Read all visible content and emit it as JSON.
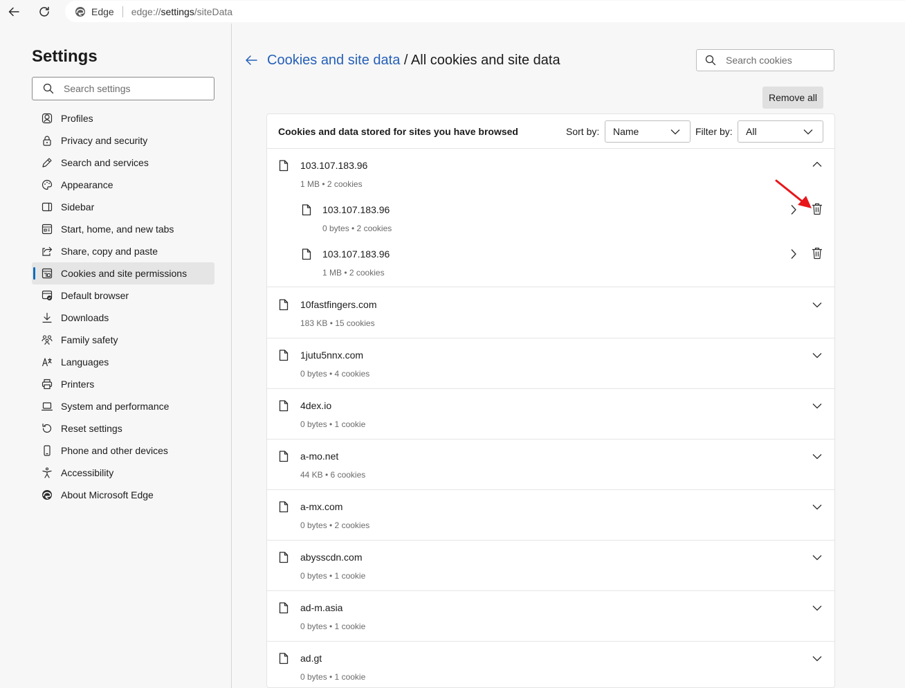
{
  "browser": {
    "brand": "Edge",
    "url_prefix": "edge://",
    "url_settings": "settings",
    "url_suffix": "/siteData"
  },
  "sidebar": {
    "title": "Settings",
    "search_placeholder": "Search settings",
    "items": [
      {
        "label": "Profiles",
        "icon": "profile-icon"
      },
      {
        "label": "Privacy and security",
        "icon": "lock-icon"
      },
      {
        "label": "Search and services",
        "icon": "pencil-icon"
      },
      {
        "label": "Appearance",
        "icon": "palette-icon"
      },
      {
        "label": "Sidebar",
        "icon": "sidebar-icon"
      },
      {
        "label": "Start, home, and new tabs",
        "icon": "home-tabs-icon"
      },
      {
        "label": "Share, copy and paste",
        "icon": "share-icon"
      },
      {
        "label": "Cookies and site permissions",
        "icon": "cookies-icon",
        "active": true
      },
      {
        "label": "Default browser",
        "icon": "default-browser-icon"
      },
      {
        "label": "Downloads",
        "icon": "download-icon"
      },
      {
        "label": "Family safety",
        "icon": "family-icon"
      },
      {
        "label": "Languages",
        "icon": "languages-icon"
      },
      {
        "label": "Printers",
        "icon": "printer-icon"
      },
      {
        "label": "System and performance",
        "icon": "laptop-icon"
      },
      {
        "label": "Reset settings",
        "icon": "reset-icon"
      },
      {
        "label": "Phone and other devices",
        "icon": "phone-icon"
      },
      {
        "label": "Accessibility",
        "icon": "accessibility-icon"
      },
      {
        "label": "About Microsoft Edge",
        "icon": "edge-logo-icon"
      }
    ]
  },
  "header": {
    "breadcrumb_link": "Cookies and site data",
    "breadcrumb_sep": " / ",
    "breadcrumb_current": "All cookies and site data",
    "search_placeholder": "Search cookies",
    "remove_all": "Remove all"
  },
  "card": {
    "title": "Cookies and data stored for sites you have browsed",
    "sort_label": "Sort by:",
    "sort_value": "Name",
    "filter_label": "Filter by:",
    "filter_value": "All"
  },
  "expanded_site": {
    "name": "103.107.183.96",
    "meta": "1 MB • 2 cookies",
    "children": [
      {
        "name": "103.107.183.96",
        "meta": "0 bytes • 2 cookies"
      },
      {
        "name": "103.107.183.96",
        "meta": "1 MB • 2 cookies"
      }
    ]
  },
  "sites": [
    {
      "name": "10fastfingers.com",
      "meta": "183 KB • 15 cookies"
    },
    {
      "name": "1jutu5nnx.com",
      "meta": "0 bytes • 4 cookies"
    },
    {
      "name": "4dex.io",
      "meta": "0 bytes • 1 cookie"
    },
    {
      "name": "a-mo.net",
      "meta": "44 KB • 6 cookies"
    },
    {
      "name": "a-mx.com",
      "meta": "0 bytes • 2 cookies"
    },
    {
      "name": "abysscdn.com",
      "meta": "0 bytes • 1 cookie"
    },
    {
      "name": "ad-m.asia",
      "meta": "0 bytes • 1 cookie"
    },
    {
      "name": "ad.gt",
      "meta": "0 bytes • 1 cookie"
    }
  ],
  "colors": {
    "accent": "#0f6cbd",
    "link": "#2560b8",
    "annotation_arrow": "#e8161b"
  }
}
